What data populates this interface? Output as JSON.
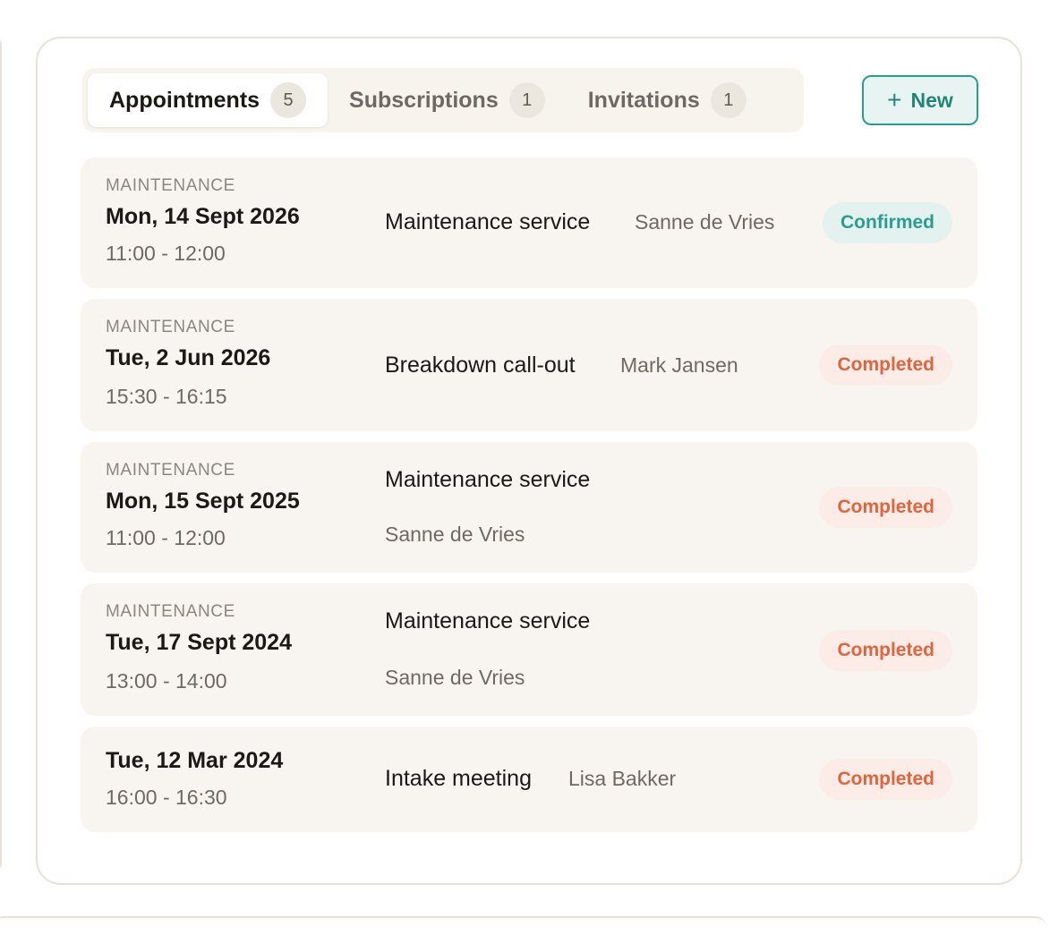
{
  "tabs": [
    {
      "label": "Appointments",
      "count": "5",
      "active": true
    },
    {
      "label": "Subscriptions",
      "count": "1",
      "active": false
    },
    {
      "label": "Invitations",
      "count": "1",
      "active": false
    }
  ],
  "new_button": {
    "icon": "plus-icon",
    "icon_glyph": "+",
    "label": "New"
  },
  "appointments": [
    {
      "category": "MAINTENANCE",
      "date": "Mon, 14 Sept 2026",
      "time": "11:00 - 12:00",
      "title": "Maintenance service",
      "person": "Sanne de Vries",
      "status": "Confirmed"
    },
    {
      "category": "MAINTENANCE",
      "date": "Tue, 2 Jun 2026",
      "time": "15:30 - 16:15",
      "title": "Breakdown call-out",
      "person": "Mark Jansen",
      "status": "Completed"
    },
    {
      "category": "MAINTENANCE",
      "date": "Mon, 15 Sept 2025",
      "time": "11:00 - 12:00",
      "title": "Maintenance service",
      "person": "Sanne de Vries",
      "status": "Completed"
    },
    {
      "category": "MAINTENANCE",
      "date": "Tue, 17 Sept 2024",
      "time": "13:00 - 14:00",
      "title": "Maintenance service",
      "person": "Sanne de Vries",
      "status": "Completed"
    },
    {
      "category": "",
      "date": "Tue, 12 Mar 2024",
      "time": "16:00 - 16:30",
      "title": "Intake meeting",
      "person": "Lisa Bakker",
      "status": "Completed"
    }
  ],
  "colors": {
    "accent_teal": "#2a9d8f",
    "completed_orange": "#e0643c",
    "row_background": "#f8f5f0",
    "card_border": "#e6e2d8"
  }
}
